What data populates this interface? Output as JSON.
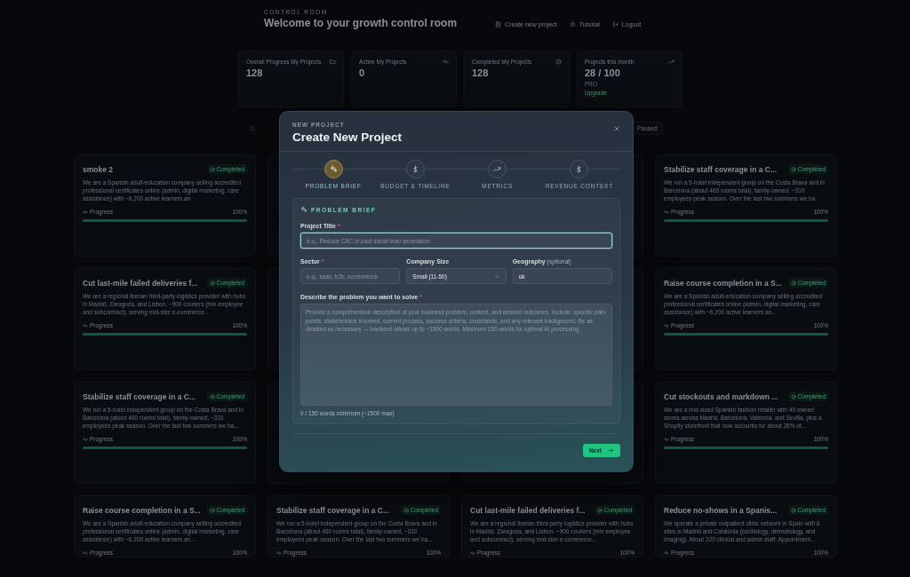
{
  "background": {
    "eyebrow": "CONTROL ROOM",
    "title": "Welcome to your growth control room",
    "actions": [
      {
        "label": "Create new project"
      },
      {
        "label": "Tutorial"
      },
      {
        "label": "Logout"
      }
    ],
    "stats": [
      {
        "label": "Overall Progress My Projects",
        "value": "128"
      },
      {
        "label": "Active My Projects",
        "value": "0"
      },
      {
        "label": "Completed My Projects",
        "value": "128"
      },
      {
        "label": "Projects this month",
        "value": "28 / 100",
        "plan": "PRO",
        "link": "Upgrade"
      }
    ],
    "filter_button": "Paused",
    "cards": [
      {
        "kind": "card",
        "title": "smoke 2",
        "status": "Completed",
        "description": "We are a Spanish adult-education company selling accredited professional certificates online (admin, digital marketing, care assistance) with ~6,200 active learners an",
        "progress_label": "Progress",
        "percent": "100%",
        "level": 1
      },
      {
        "kind": "covered"
      },
      {
        "kind": "covered"
      },
      {
        "kind": "card",
        "title": "Stabilize staff coverage in a C...",
        "status": "Completed",
        "description": "We run a 5-hotel independent group on the Costa Brava and in Barcelona (about 460 rooms total), family-owned, ~310 employees peak season. Over the last two summers we ha",
        "progress_label": "Progress",
        "percent": "100%",
        "level": 1
      },
      {
        "kind": "card",
        "title": "Cut last-mile failed deliveries f...",
        "status": "Completed",
        "description": "We are a regional Iberian third-party logistics provider with hubs in Madrid, Zaragoza, and Lisbon. ~900 couriers (mix employee and subcontract), serving mid-size e-commerce...",
        "progress_label": "Progress",
        "percent": "100%",
        "level": 1
      },
      {
        "kind": "covered"
      },
      {
        "kind": "covered"
      },
      {
        "kind": "card",
        "title": "Raise course completion in a S...",
        "status": "Completed",
        "description": "We are a Spanish adult-education company selling accredited professional certificates online (admin, digital marketing, care assistance) with ~6,200 active learners an...",
        "progress_label": "Progress",
        "percent": "100%",
        "level": 1
      },
      {
        "kind": "card",
        "title": "Stabilize staff coverage in a C...",
        "status": "Completed",
        "description": "We run a 5-hotel independent group on the Costa Brava and in Barcelona (about 460 rooms total), family-owned, ~310 employees peak season. Over the last two summers we ha...",
        "progress_label": "Progress",
        "percent": "100%",
        "level": 1
      },
      {
        "kind": "covered"
      },
      {
        "kind": "covered"
      },
      {
        "kind": "card",
        "title": "Cut stockouts and markdown ...",
        "status": "Completed",
        "description": "We are a mid-sized Spanish fashion retailer with 40 owned stores across Madrid, Barcelona, Valencia, and Sevilla, plus a Shopify storefront that now accounts for about 28% of...",
        "progress_label": "Progress",
        "percent": "100%",
        "level": 1
      },
      {
        "kind": "card",
        "title": "Raise course completion in a S...",
        "status": "Completed",
        "description": "We are a Spanish adult-education company selling accredited professional certificates online (admin, digital marketing, care assistance) with ~6,200 active learners an...",
        "progress_label": "Progress",
        "percent": "100%"
      },
      {
        "kind": "card",
        "title": "Stabilize staff coverage in a C...",
        "status": "Completed",
        "description": "We run a 5-hotel independent group on the Costa Brava and in Barcelona (about 460 rooms total), family-owned, ~310 employees peak season. Over the last two summers we ha...",
        "progress_label": "Progress",
        "percent": "100%"
      },
      {
        "kind": "card",
        "title": "Cut last-mile failed deliveries f...",
        "status": "Completed",
        "description": "We are a regional Iberian third-party logistics provider with hubs in Madrid, Zaragoza, and Lisbon. ~900 couriers (mix employee and subcontract), serving mid-size e-commerce...",
        "progress_label": "Progress",
        "percent": "100%"
      },
      {
        "kind": "card",
        "title": "Reduce no-shows in a Spanis...",
        "status": "Completed",
        "description": "We operate a private outpatient clinic network in Spain with 6 sites in Madrid and Catalonia (cardiology, dermatology, and imaging). About 220 clinical and admin staff. Appointment...",
        "progress_label": "Progress",
        "percent": "100%"
      }
    ]
  },
  "modal": {
    "eyebrow": "NEW PROJECT",
    "title": "Create New Project",
    "steps": [
      {
        "label": "PROBLEM BRIEF",
        "selected": true
      },
      {
        "label": "BUDGET & TIMELINE",
        "selected": false
      },
      {
        "label": "METRICS",
        "selected": false
      },
      {
        "label": "REVENUE CONTEXT",
        "selected": false
      }
    ],
    "section_title": "PROBLEM BRIEF",
    "project_title": {
      "label": "Project Title",
      "required_mark": "*",
      "placeholder": "e.g., Reduce CAC in paid social lead generation",
      "focused": true
    },
    "row_fields": [
      {
        "kind": "input",
        "label": "Sector",
        "required_mark": "*",
        "placeholder": "e.g., saas, b2b, ecommerce"
      },
      {
        "kind": "select",
        "label": "Company Size",
        "value": "Small (11-50)"
      },
      {
        "kind": "input",
        "label": "Geography",
        "hint": "(optional)",
        "value": "uk"
      }
    ],
    "problem": {
      "label": "Describe the problem you want to solve",
      "required_mark": "*",
      "placeholder": "Provide a comprehensive description of your business problem, context, and desired outcomes. Include: specific pain points, stakeholders involved, current process, success criteria, constraints, and any relevant background. Be as detailed as necessary — backend allows up to ~1500 words. Minimum 150 words for optimal AI processing.",
      "counter": "0 / 150 words minimum (~1500 max)"
    },
    "next_button": "Next"
  }
}
